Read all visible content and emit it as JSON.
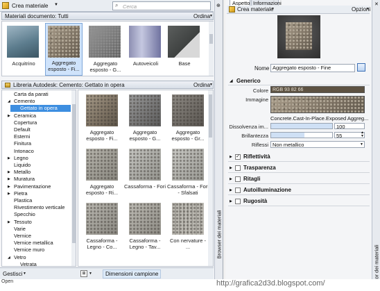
{
  "left": {
    "topbar": {
      "menu_label": "Crea materiale",
      "search_placeholder": "Cerca"
    },
    "doc_header": {
      "title": "Materiali documento: Tutti",
      "sort_label": "Ordina"
    },
    "doc_materials": [
      {
        "label": "Acquitrino"
      },
      {
        "label": "Aggregato esposto - Fi..."
      },
      {
        "label": "Aggregato esposto - G..."
      },
      {
        "label": "Autoveicoli"
      },
      {
        "label": "Base"
      }
    ],
    "lib_header": {
      "title": "Libreria Autodesk: Cemento: Gettato in opera",
      "sort_label": "Ordina"
    },
    "tree": [
      {
        "label": "Carta da parati",
        "indent": 0,
        "arrow": ""
      },
      {
        "label": "Cemento",
        "indent": 0,
        "arrow": "down"
      },
      {
        "label": "Gettato in opera",
        "indent": 1,
        "arrow": "",
        "selected": true
      },
      {
        "label": "Ceramica",
        "indent": 0,
        "arrow": "right"
      },
      {
        "label": "Copertura",
        "indent": 0,
        "arrow": ""
      },
      {
        "label": "Default",
        "indent": 0,
        "arrow": ""
      },
      {
        "label": "Esterni",
        "indent": 0,
        "arrow": ""
      },
      {
        "label": "Finitura",
        "indent": 0,
        "arrow": ""
      },
      {
        "label": "Intonaco",
        "indent": 0,
        "arrow": ""
      },
      {
        "label": "Legno",
        "indent": 0,
        "arrow": "right"
      },
      {
        "label": "Liquido",
        "indent": 0,
        "arrow": ""
      },
      {
        "label": "Metallo",
        "indent": 0,
        "arrow": "right"
      },
      {
        "label": "Muratura",
        "indent": 0,
        "arrow": "right"
      },
      {
        "label": "Pavimentazione",
        "indent": 0,
        "arrow": "right"
      },
      {
        "label": "Pietra",
        "indent": 0,
        "arrow": "right"
      },
      {
        "label": "Plastica",
        "indent": 0,
        "arrow": ""
      },
      {
        "label": "Rivestimento verticale",
        "indent": 0,
        "arrow": ""
      },
      {
        "label": "Specchio",
        "indent": 0,
        "arrow": ""
      },
      {
        "label": "Tessuto",
        "indent": 0,
        "arrow": "right"
      },
      {
        "label": "Varie",
        "indent": 0,
        "arrow": ""
      },
      {
        "label": "Vernice",
        "indent": 0,
        "arrow": ""
      },
      {
        "label": "Vernice metallica",
        "indent": 0,
        "arrow": ""
      },
      {
        "label": "Vernice muro",
        "indent": 0,
        "arrow": ""
      },
      {
        "label": "Vetro",
        "indent": 0,
        "arrow": "down"
      },
      {
        "label": "Vetrata",
        "indent": 1,
        "arrow": ""
      }
    ],
    "lib_materials": [
      {
        "label": "Aggregato esposto - Fi..."
      },
      {
        "label": "Aggregato esposto - G..."
      },
      {
        "label": "Aggregato esposto - Gr..."
      },
      {
        "label": "Aggregato esposto - Ri..."
      },
      {
        "label": "Cassaforma - Fori"
      },
      {
        "label": "Cassaforma - Fori - Sfalsati"
      },
      {
        "label": "Cassaforma - Legno - Co..."
      },
      {
        "label": "Cassaforma - Legno - Tav..."
      },
      {
        "label": "Con nervature - ..."
      }
    ],
    "bottom": {
      "manage_label": "Gestisci",
      "size_label": "Dimensioni campione"
    },
    "side_tab": "Browser dei materiali"
  },
  "right": {
    "tabs": [
      {
        "label": "Aspetto"
      },
      {
        "label": "Informazioni"
      }
    ],
    "toolbar": {
      "create_label": "Crea materiale",
      "options_label": "Opzioni"
    },
    "name_label": "Nome",
    "name_value": "Aggregato esposto - Fine",
    "generic": {
      "title": "Generico",
      "color_label": "Colore",
      "color_value": "RGB 93 82 66",
      "color_hex": "#5d5242",
      "image_label": "Immagine",
      "image_name": "Concrete.Cast-In-Place.Exposed Aggreg...",
      "dissolve_label": "Dissolvenza im...",
      "dissolve_value": "100",
      "gloss_label": "Brillantezza",
      "gloss_value": "55",
      "highlights_label": "Riflessi",
      "highlights_value": "Non metallico"
    },
    "sections": [
      {
        "label": "Riflettività",
        "checked": true
      },
      {
        "label": "Trasparenza",
        "checked": false
      },
      {
        "label": "Ritagli",
        "checked": false
      },
      {
        "label": "Autoilluminazione",
        "checked": false
      },
      {
        "label": "Rugosità",
        "checked": false
      }
    ],
    "side_tab": "Editor dei materiali"
  },
  "watermark": "http://grafica2d3d.blogspot.com/",
  "status_left": "Open"
}
